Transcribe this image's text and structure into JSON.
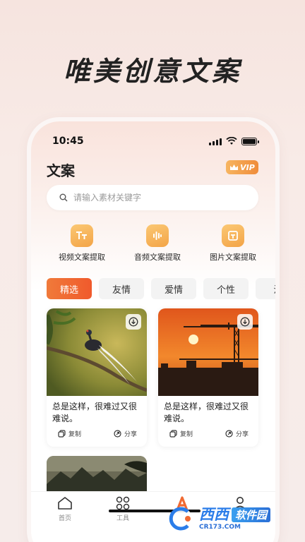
{
  "promo": {
    "headline": "唯美创意文案"
  },
  "status": {
    "time": "10:45"
  },
  "header": {
    "title": "文案",
    "vip_label": "VIP"
  },
  "search": {
    "placeholder": "请输入素材关键字"
  },
  "tools": [
    {
      "label": "视频文案提取",
      "icon": "text-icon"
    },
    {
      "label": "音频文案提取",
      "icon": "audio-wave-icon"
    },
    {
      "label": "图片文案提取",
      "icon": "image-text-icon"
    }
  ],
  "tabs": [
    {
      "label": "精选",
      "active": true
    },
    {
      "label": "友情"
    },
    {
      "label": "爱情"
    },
    {
      "label": "个性"
    },
    {
      "label": "治"
    }
  ],
  "cards": [
    {
      "text": "总是这样，很难过又很难说。",
      "copy_label": "复制",
      "share_label": "分享",
      "image": "bird-on-branch"
    },
    {
      "text": "总是这样，很难过又很难说。",
      "copy_label": "复制",
      "share_label": "分享",
      "image": "sunset-construction-cranes"
    },
    {
      "image": "mountain-landscape"
    }
  ],
  "nav": [
    {
      "label": "首页",
      "icon": "home-icon"
    },
    {
      "label": "工具",
      "icon": "grid-icon"
    },
    {
      "label": "",
      "icon": "app-logo-icon"
    },
    {
      "label": "",
      "icon": "profile-icon"
    }
  ],
  "watermark": {
    "brand": "西西",
    "sub": "软件园",
    "url": "CR173.COM"
  },
  "colors": {
    "accent": "#f06a33",
    "tool_icon": "#f3a447",
    "vip": "#ef8c3a"
  }
}
